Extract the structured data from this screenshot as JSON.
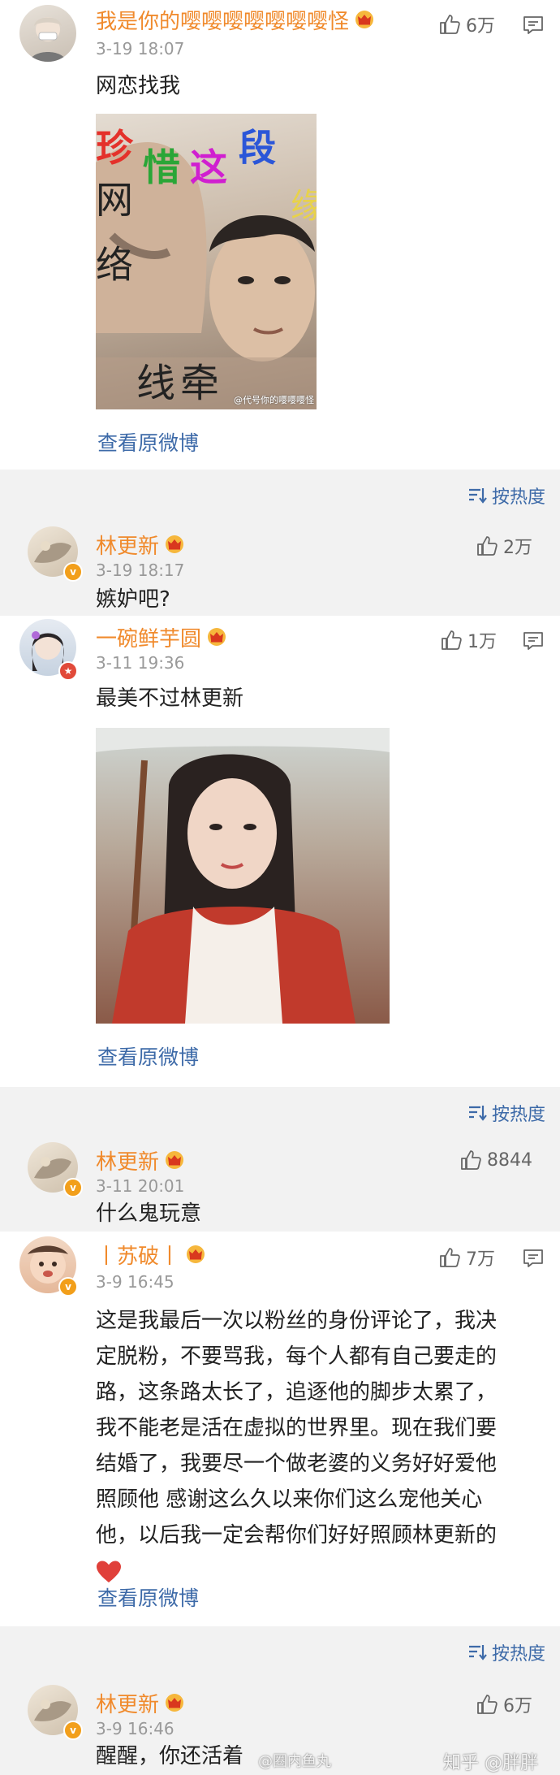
{
  "post": {
    "name": "我是你的嘤嘤嘤嘤嘤嘤嘤怪",
    "time": "3-19 18:07",
    "likes": "6万",
    "text": "网恋找我",
    "image_text": [
      "珍",
      "惜",
      "这",
      "段",
      "网",
      "络",
      "线",
      "牵",
      "缘"
    ],
    "image_watermark": "@代号你的嘤嘤嘤怪",
    "view_link": "查看原微博"
  },
  "sort_label": "按热度",
  "reply1": {
    "name": "林更新",
    "time": "3-19 18:17",
    "likes": "2万",
    "text": "嫉妒吧?"
  },
  "post2": {
    "name": "一碗鲜芋圆",
    "time": "3-11 19:36",
    "likes": "1万",
    "text": "最美不过林更新",
    "view_link": "查看原微博"
  },
  "reply2": {
    "name": "林更新",
    "time": "3-11 20:01",
    "likes": "8844",
    "text": "什么鬼玩意"
  },
  "post3": {
    "name": "丨苏破丨",
    "time": "3-9 16:45",
    "likes": "7万",
    "lines": [
      "这是我最后一次以粉丝的身份评论了，我决",
      "定脱粉，不要骂我，每个人都有自己要走的",
      "路，这条路太长了，追逐他的脚步太累了，",
      "我不能老是活在虚拟的世界里。现在我们要",
      "结婚了，我要尽一个做老婆的义务好好爱他",
      "照顾他 感谢这么久以来你们这么宠他关心",
      "他，以后我一定会帮你们好好照顾林更新的"
    ],
    "view_link": "查看原微博"
  },
  "reply3": {
    "name": "林更新",
    "time": "3-9 16:46",
    "likes": "6万",
    "text": "醒醒，你还活着"
  },
  "footer_watermark": {
    "left": "@圈内鱼丸",
    "right": "知乎 @胖胖"
  },
  "colors": {
    "name": "#f08a2c",
    "link": "#3d6aa8",
    "gray_bg": "#f2f2f2",
    "heart": "#e0403a"
  },
  "icons": [
    "thumb-up-icon",
    "comment-icon",
    "crown-icon",
    "sort-icon",
    "heart-icon",
    "verified-badge-icon"
  ]
}
